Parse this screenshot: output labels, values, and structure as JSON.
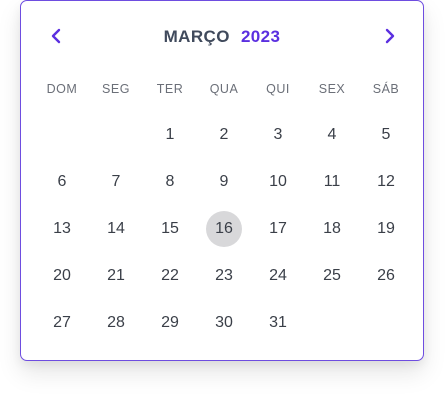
{
  "calendar": {
    "month": "MARÇO",
    "year": "2023",
    "weekdays": [
      "DOM",
      "SEG",
      "TER",
      "QUA",
      "QUI",
      "SEX",
      "SÁB"
    ],
    "first_weekday_index": 2,
    "days": [
      "1",
      "2",
      "3",
      "4",
      "5",
      "6",
      "7",
      "8",
      "9",
      "10",
      "11",
      "12",
      "13",
      "14",
      "15",
      "16",
      "17",
      "18",
      "19",
      "20",
      "21",
      "22",
      "23",
      "24",
      "25",
      "26",
      "27",
      "28",
      "29",
      "30",
      "31"
    ],
    "highlighted_day": "16",
    "colors": {
      "accent": "#5b2fe0",
      "border": "#6e4de0",
      "month_text": "#404a5c",
      "day_text": "#3a3f48",
      "weekday_text": "#6b6f78",
      "highlight_bg": "#d8d8da"
    }
  },
  "icons": {
    "prev": "chevron-left-icon",
    "next": "chevron-right-icon"
  }
}
